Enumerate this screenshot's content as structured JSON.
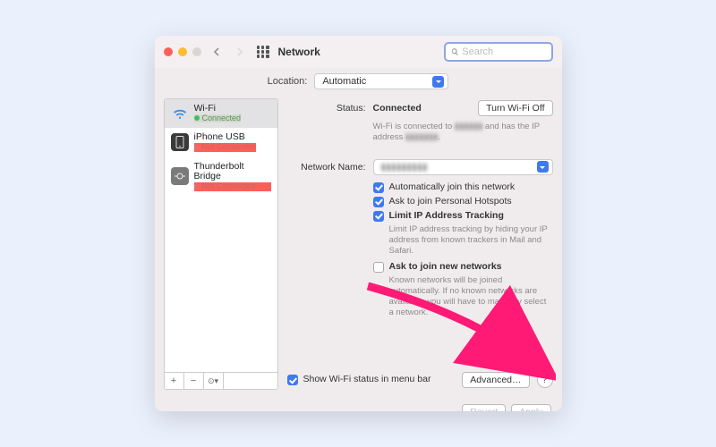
{
  "window": {
    "title": "Network",
    "search_placeholder": "Search"
  },
  "location": {
    "label": "Location:",
    "value": "Automatic"
  },
  "sidebar": {
    "items": [
      {
        "name": "Wi-Fi",
        "status": "Connected",
        "dot": "green"
      },
      {
        "name": "iPhone USB",
        "status": "Not Connected",
        "dot": "red"
      },
      {
        "name": "Thunderbolt Bridge",
        "status": "Not Connected",
        "dot": "red"
      }
    ]
  },
  "status": {
    "label": "Status:",
    "value": "Connected",
    "wifi_off": "Turn Wi-Fi Off",
    "desc_prefix": "Wi-Fi is connected to ",
    "desc_mid": "▮▮▮▮▮▮",
    "desc_suffix": " and has the IP address ",
    "desc_ip": "▮▮▮▮▮▮▮"
  },
  "network": {
    "label": "Network Name:",
    "value": "▮▮▮▮▮▮▮▮▮",
    "auto_join": "Automatically join this network",
    "ask_hotspot": "Ask to join Personal Hotspots",
    "limit_ip": "Limit IP Address Tracking",
    "limit_ip_desc": "Limit IP address tracking by hiding your IP address from known trackers in Mail and Safari.",
    "ask_new": "Ask to join new networks",
    "ask_new_desc": "Known networks will be joined automatically. If no known networks are available, you will have to manually select a network."
  },
  "menubar_check": "Show Wi-Fi status in menu bar",
  "advanced": "Advanced…",
  "revert": "Revert",
  "apply": "Apply"
}
